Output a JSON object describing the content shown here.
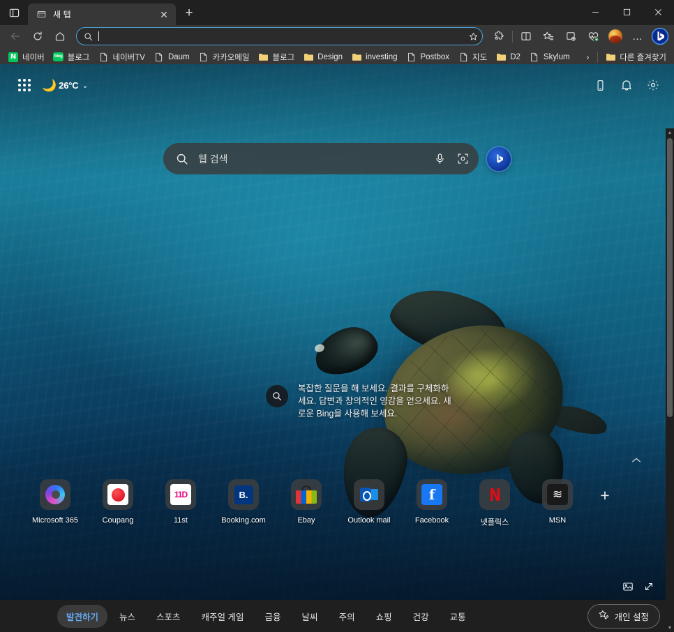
{
  "window": {
    "controls": {
      "minimize": "–",
      "maximize": "☐",
      "close": "✕"
    }
  },
  "tabstrip": {
    "tab_search_icon": "tab-search-icon",
    "tabs": [
      {
        "title": "새 탭",
        "favicon": "new-tab-icon",
        "close_label": "✕"
      }
    ],
    "new_tab_label": "+"
  },
  "toolbar": {
    "back_icon": "back-arrow-icon",
    "refresh_icon": "refresh-icon",
    "home_icon": "home-icon",
    "omnibox": {
      "value": "",
      "placeholder": "",
      "search_icon": "search-icon",
      "favorite_icon": "star-outline-icon"
    },
    "right_icons": [
      {
        "name": "extensions-icon",
        "glyph": "puzzle"
      },
      {
        "name": "split-screen-icon",
        "glyph": "split"
      },
      {
        "name": "favorites-icon",
        "glyph": "star-list"
      },
      {
        "name": "collections-icon",
        "glyph": "collections"
      },
      {
        "name": "browser-essentials-icon",
        "glyph": "heart-pulse"
      }
    ],
    "profile_name": "profile-avatar",
    "settings_more_label": "…",
    "bing_copilot_label": "b"
  },
  "bookmarks": {
    "items": [
      {
        "label": "네이버",
        "icon": "naver-icon"
      },
      {
        "label": "블로그",
        "icon": "naver-blog-icon"
      },
      {
        "label": "네이버TV",
        "icon": "page-icon"
      },
      {
        "label": "Daum",
        "icon": "page-icon"
      },
      {
        "label": "카카오메일",
        "icon": "page-icon"
      },
      {
        "label": "블로그",
        "icon": "folder-icon"
      },
      {
        "label": "Design",
        "icon": "folder-icon"
      },
      {
        "label": "investing",
        "icon": "folder-icon"
      },
      {
        "label": "Postbox",
        "icon": "page-icon"
      },
      {
        "label": "지도",
        "icon": "page-icon"
      },
      {
        "label": "D2",
        "icon": "folder-icon"
      },
      {
        "label": "Skylum",
        "icon": "page-icon"
      }
    ],
    "overflow_chevron": "›",
    "other_favorites": {
      "label": "다른 즐겨찾기",
      "icon": "folder-icon"
    }
  },
  "ntp": {
    "waffle_icon": "app-launcher-icon",
    "weather": {
      "icon": "moon-icon",
      "glyph": "🌙",
      "temperature": "26°C",
      "chevron": "⌄"
    },
    "top_right_icons": [
      {
        "name": "mobile-device-icon"
      },
      {
        "name": "notifications-bell-icon"
      },
      {
        "name": "settings-gear-icon"
      }
    ],
    "search": {
      "placeholder": "웹 검색",
      "value": "",
      "search_icon": "search-icon",
      "mic_icon": "microphone-icon",
      "lens_icon": "visual-search-icon",
      "chat_icon": "bing-chat-icon"
    },
    "callout": {
      "badge_icon": "search-badge-icon",
      "text": "복잡한 질문을 해 보세요. 결과를 구체화하세요. 답변과 창의적인 영감을 얻으세요. 새로운 Bing을 사용해 보세요."
    },
    "collapse_chevron": "⌃",
    "shortcuts": [
      {
        "label": "Microsoft 365",
        "icon": "microsoft-365-icon"
      },
      {
        "label": "Coupang",
        "icon": "coupang-icon"
      },
      {
        "label": "11st",
        "icon": "11st-icon",
        "text": "11D"
      },
      {
        "label": "Booking.com",
        "icon": "booking-icon",
        "text": "B."
      },
      {
        "label": "Ebay",
        "icon": "ebay-icon"
      },
      {
        "label": "Outlook mail",
        "icon": "outlook-icon"
      },
      {
        "label": "Facebook",
        "icon": "facebook-icon",
        "text": "f"
      },
      {
        "label": "넷플릭스",
        "icon": "netflix-icon",
        "text": "N"
      },
      {
        "label": "MSN",
        "icon": "msn-icon",
        "text": "≋"
      }
    ],
    "add_shortcut_label": "+",
    "background_controls": [
      {
        "name": "image-credit-icon"
      },
      {
        "name": "expand-fullscreen-icon"
      }
    ]
  },
  "bottom_nav": {
    "tabs": [
      {
        "label": "발견하기",
        "active": true
      },
      {
        "label": "뉴스",
        "active": false
      },
      {
        "label": "스포츠",
        "active": false
      },
      {
        "label": "캐주얼 게임",
        "active": false
      },
      {
        "label": "금융",
        "active": false
      },
      {
        "label": "날씨",
        "active": false
      },
      {
        "label": "주의",
        "active": false
      },
      {
        "label": "쇼핑",
        "active": false
      },
      {
        "label": "건강",
        "active": false
      },
      {
        "label": "교통",
        "active": false
      }
    ],
    "personalize": {
      "label": "개인 설정",
      "icon": "personalize-star-icon"
    }
  },
  "colors": {
    "accent_blue": "#64a8f0",
    "omnibox_border": "#4da3d8",
    "tab_active": "#373737",
    "chrome_bg": "#202020",
    "toolbar_bg": "#373737",
    "bottom_nav_bg": "#1f1f1f"
  },
  "scrollbar": {
    "up": "▲",
    "down": "▼"
  }
}
